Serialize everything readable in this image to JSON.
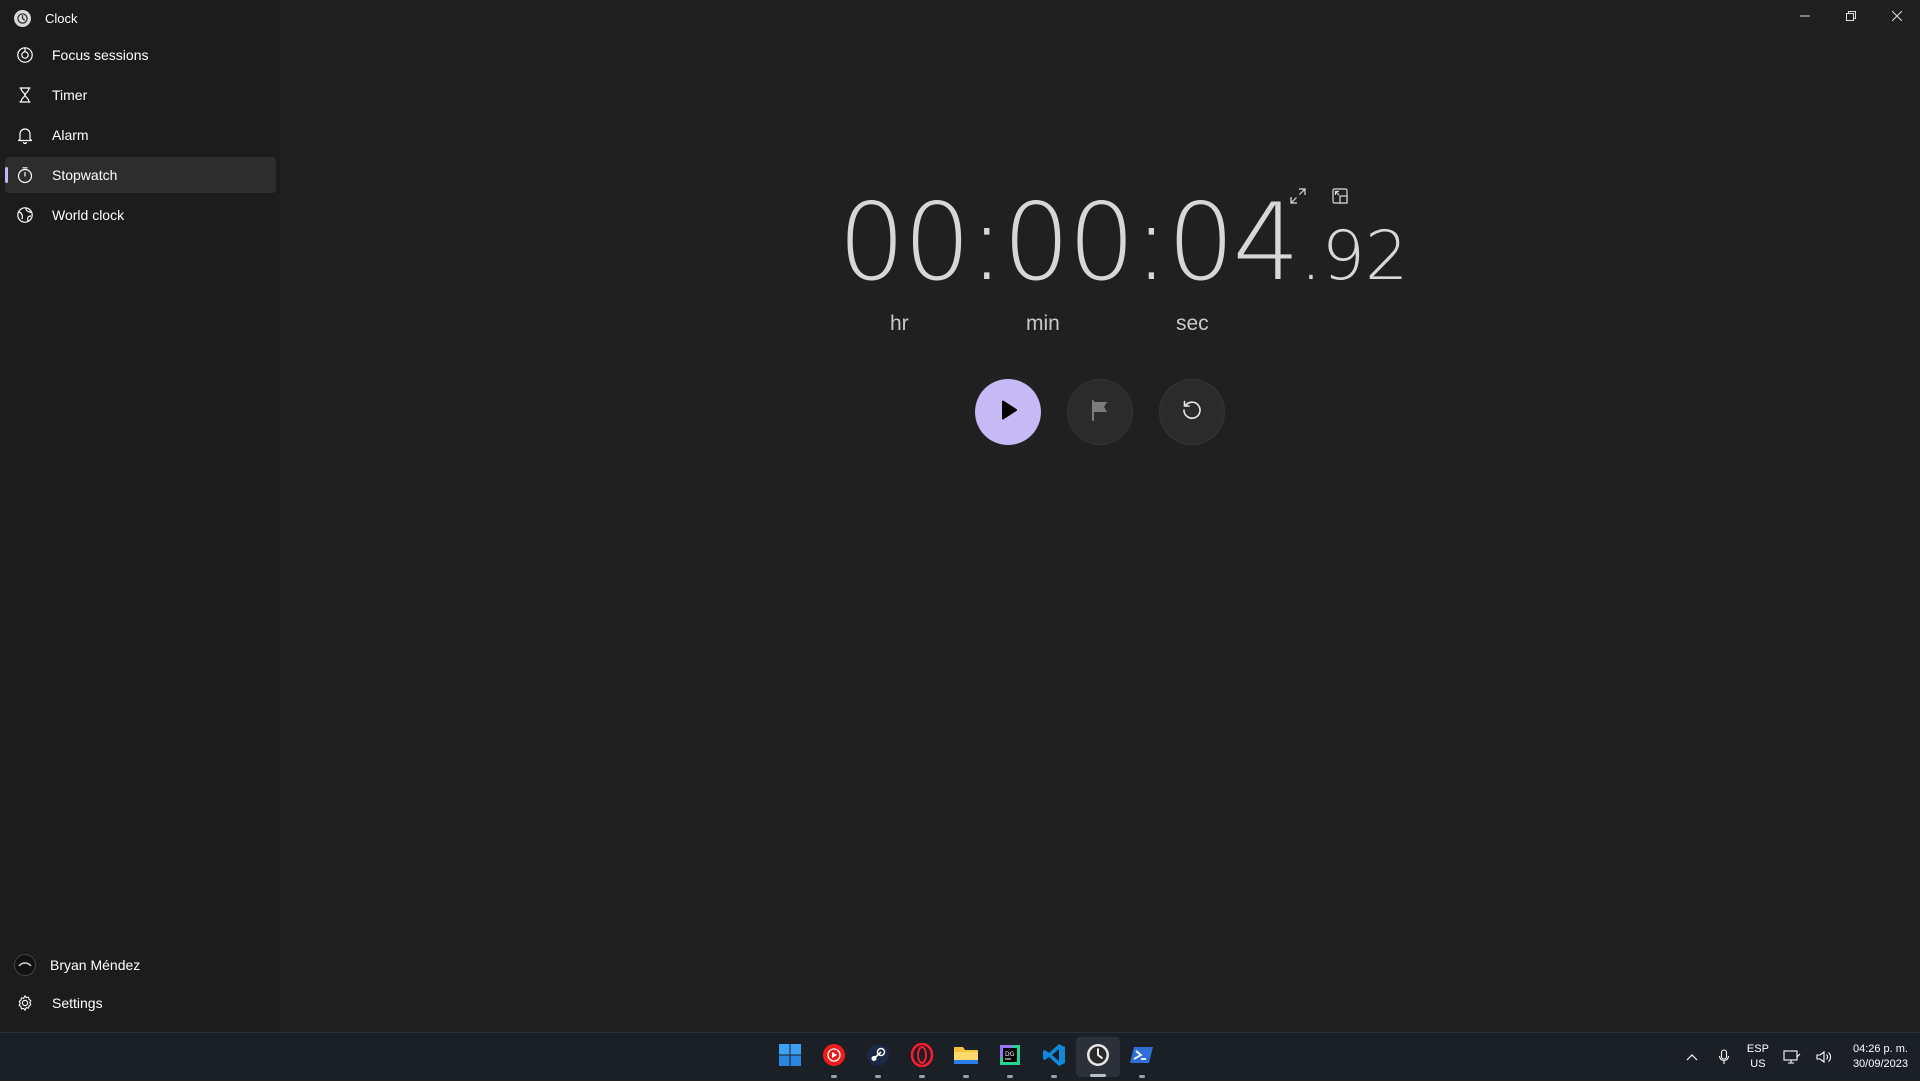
{
  "app": {
    "title": "Clock"
  },
  "sidebar": {
    "items": [
      {
        "label": "Focus sessions",
        "icon": "focus-icon"
      },
      {
        "label": "Timer",
        "icon": "hourglass-icon"
      },
      {
        "label": "Alarm",
        "icon": "bell-icon"
      },
      {
        "label": "Stopwatch",
        "icon": "stopwatch-icon",
        "active": true
      },
      {
        "label": "World clock",
        "icon": "globe-icon"
      }
    ],
    "account": {
      "name": "Bryan Méndez"
    },
    "settings_label": "Settings"
  },
  "stopwatch": {
    "time_main": "00:00:04",
    "time_fraction": ".92",
    "labels": {
      "hr": "hr",
      "min": "min",
      "sec": "sec"
    }
  },
  "taskbar": {
    "apps": [
      "windows-start-icon",
      "youtube-music-icon",
      "steam-icon",
      "opera-icon",
      "file-explorer-icon",
      "datagrip-icon",
      "vscode-icon",
      "clock-app-icon",
      "powershell-icon"
    ],
    "active_app": "clock-app-icon",
    "tray": {
      "lang_line1": "ESP",
      "lang_line2": "US",
      "time": "04:26 p. m.",
      "date": "30/09/2023"
    }
  },
  "colors": {
    "accent": "#c7b9f5",
    "background": "#202020",
    "sidebar": "#1c1c1c",
    "taskbar": "#1b1f26"
  }
}
